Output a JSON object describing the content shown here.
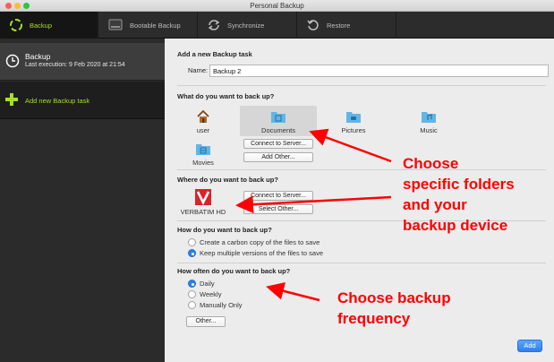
{
  "window": {
    "title": "Personal Backup"
  },
  "tabs": [
    {
      "label": "Backup"
    },
    {
      "label": "Bootable Backup"
    },
    {
      "label": "Synchronize"
    },
    {
      "label": "Restore"
    }
  ],
  "sidebar": {
    "task_name": "Backup",
    "task_sub": "Last execution: 9 Feb 2020 at 21:54",
    "add_label": "Add new Backup task"
  },
  "form": {
    "section_title": "Add a new Backup task",
    "name_label": "Name:",
    "name_value": "Backup 2",
    "what_title": "What do you want to back up?",
    "sources": [
      {
        "label": "user",
        "icon": "home-icon"
      },
      {
        "label": "Documents",
        "icon": "documents-folder-icon",
        "selected": true
      },
      {
        "label": "Pictures",
        "icon": "pictures-folder-icon"
      },
      {
        "label": "Music",
        "icon": "music-folder-icon"
      },
      {
        "label": "Movies",
        "icon": "movies-folder-icon"
      }
    ],
    "connect_server": "Connect to Server...",
    "add_other": "Add Other...",
    "where_title": "Where do you want to back up?",
    "device_label": "VERBATIM HD",
    "dest_connect": "Connect to Server...",
    "dest_select": "Select Other...",
    "how_title": "How do you want to back up?",
    "how_options": [
      {
        "label": "Create a carbon copy of the files to save",
        "selected": false
      },
      {
        "label": "Keep multiple versions of the files to save",
        "selected": true
      }
    ],
    "often_title": "How often do you want to back up?",
    "often_options": [
      {
        "label": "Daily",
        "selected": true
      },
      {
        "label": "Weekly",
        "selected": false
      },
      {
        "label": "Manually Only",
        "selected": false
      }
    ],
    "other_button": "Other...",
    "add_button": "Add"
  },
  "annotations": {
    "folders_line1": "Choose",
    "folders_line2": "specific folders",
    "folders_line3": "and your",
    "folders_line4": "backup device",
    "freq_line1": "Choose backup",
    "freq_line2": "frequency",
    "color": "#ff0000"
  },
  "colors": {
    "accent_green": "#a6e022",
    "folder_blue": "#5fb6ea",
    "select_blue": "#2a82ea",
    "device_red": "#d8232a"
  }
}
